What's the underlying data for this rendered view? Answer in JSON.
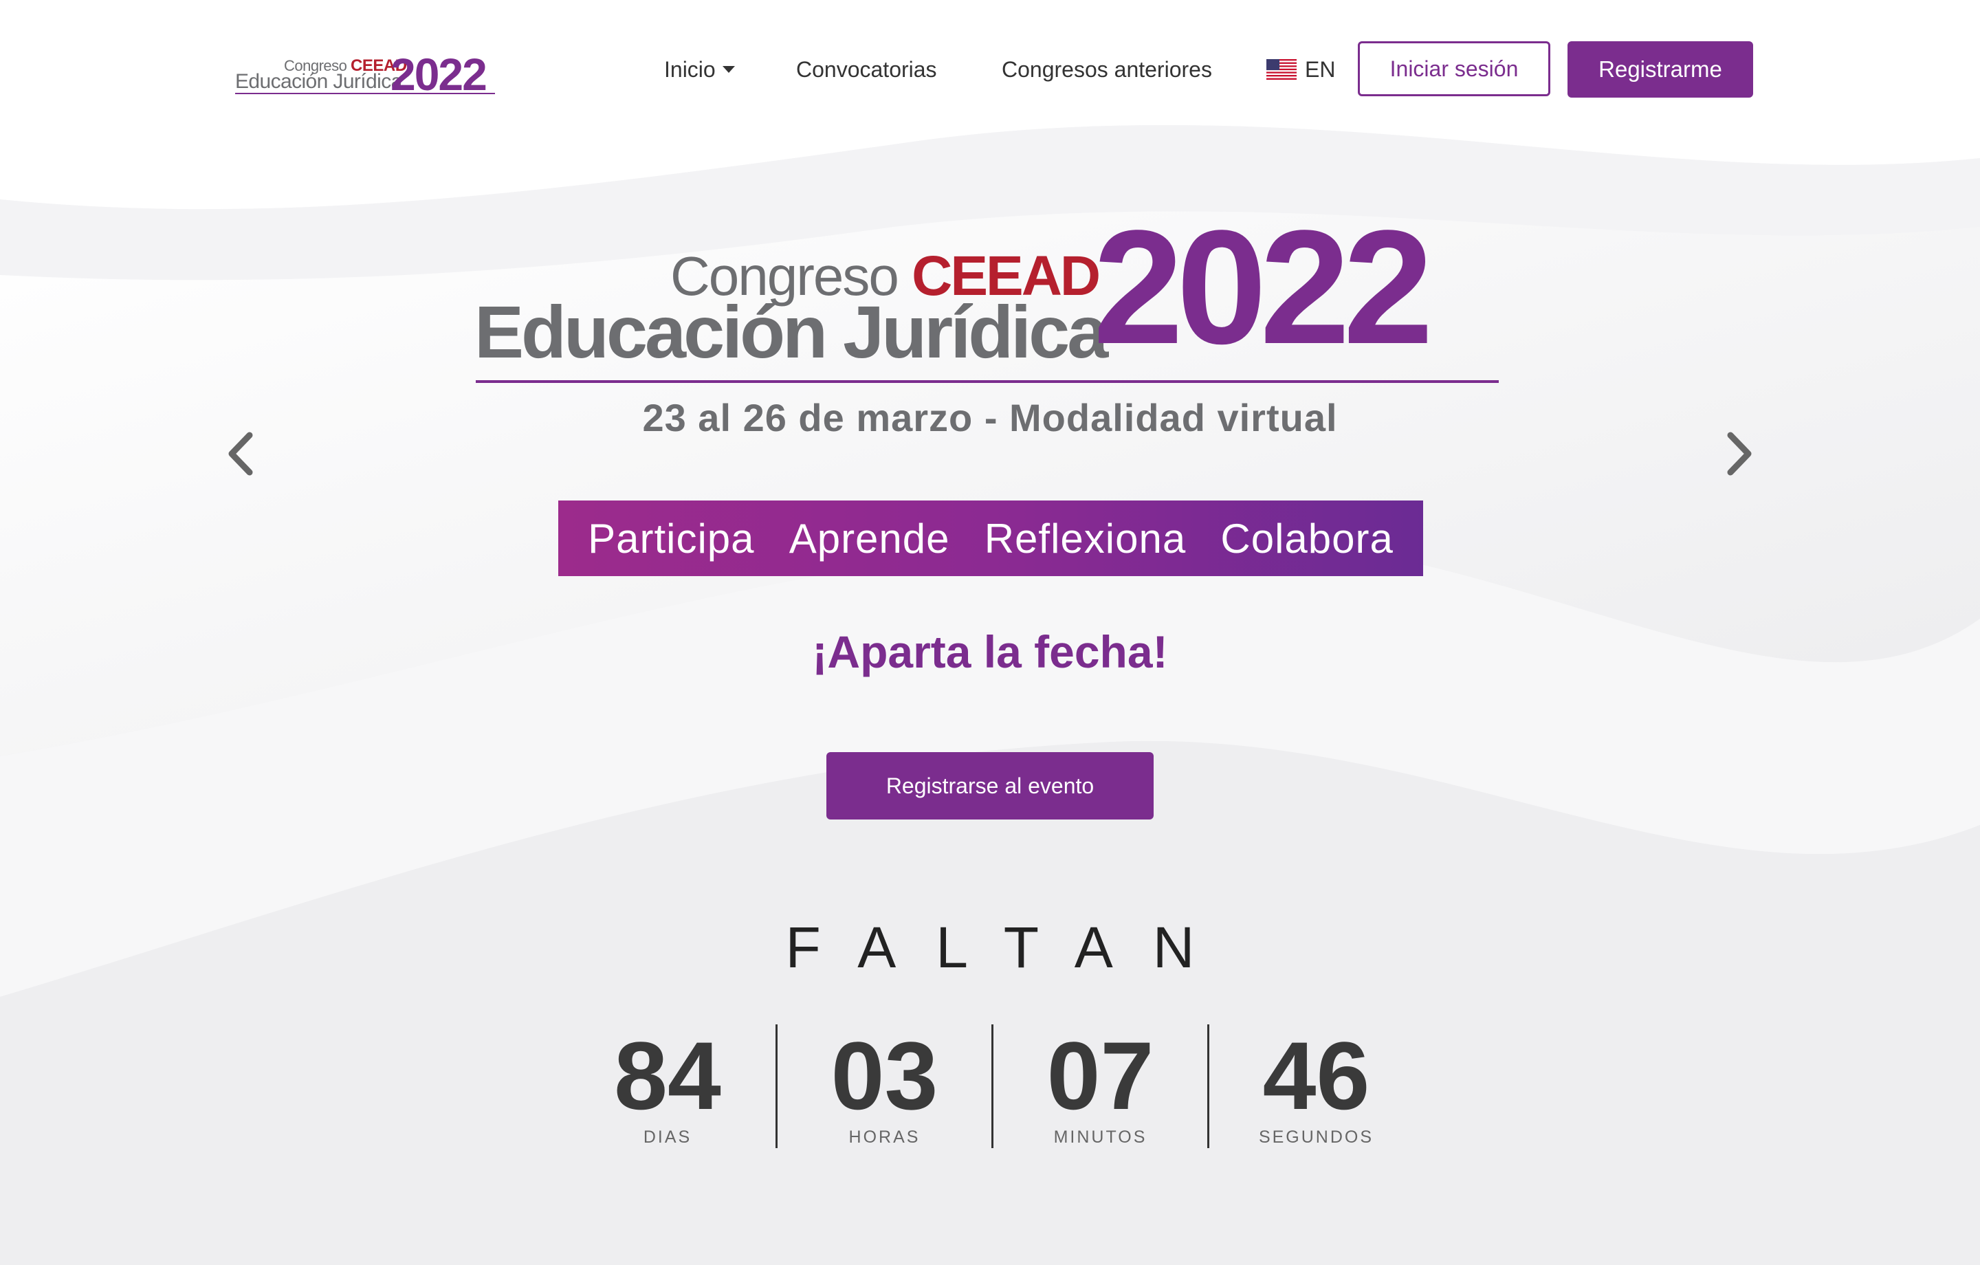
{
  "header": {
    "logo": {
      "line1": "Congreso",
      "ceead": "CEEAD",
      "line2": "Educación Jurídica",
      "year": "2022"
    },
    "nav": {
      "inicio": "Inicio",
      "convocatorias": "Convocatorias",
      "congresos_anteriores": "Congresos anteriores"
    },
    "lang": {
      "label": "EN",
      "flag_icon": "us-flag-icon"
    },
    "login_label": "Iniciar sesión",
    "register_label": "Registrarme"
  },
  "hero": {
    "logo": {
      "line1": "Congreso",
      "ceead": "CEEAD",
      "line2": "Educación Jurídica",
      "year": "2022"
    },
    "subtitle": "23 al 26 de marzo - Modalidad virtual",
    "banner": [
      "Participa",
      "Aprende",
      "Reflexiona",
      "Colabora"
    ],
    "tagline": "¡Aparta la fecha!",
    "cta_label": "Registrarse al evento",
    "prev_icon": "chevron-left-icon",
    "next_icon": "chevron-right-icon"
  },
  "countdown": {
    "title": "FALTAN",
    "units": [
      {
        "value": "84",
        "label": "DIAS"
      },
      {
        "value": "03",
        "label": "HORAS"
      },
      {
        "value": "07",
        "label": "MINUTOS"
      },
      {
        "value": "46",
        "label": "SEGUNDOS"
      }
    ]
  },
  "colors": {
    "brand_purple": "#7b2d8e",
    "ceead_red": "#b5202e",
    "gray_text": "#6d6e71"
  }
}
